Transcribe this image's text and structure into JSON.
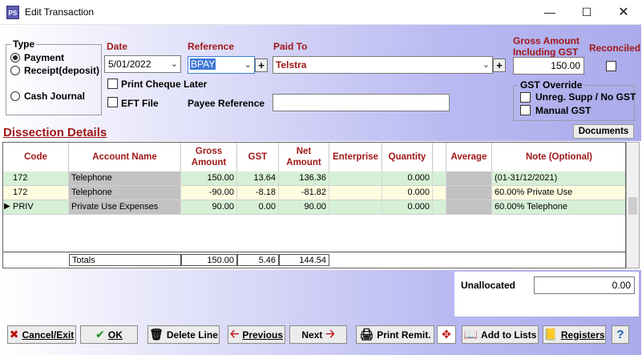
{
  "window": {
    "app_icon_text": "PS",
    "title": "Edit Transaction"
  },
  "type_group": {
    "legend": "Type",
    "options": [
      "Payment",
      "Receipt(deposit)",
      "Cash Journal"
    ],
    "selected": "Payment"
  },
  "fields": {
    "date_label": "Date",
    "date_value": "5/01/2022",
    "reference_label": "Reference",
    "reference_value": "BPAY",
    "paid_to_label": "Paid To",
    "paid_to_value": "Telstra",
    "gross_label": "Gross Amount Including GST",
    "gross_value": "150.00",
    "reconciled_label": "Reconciled",
    "print_cheque_label": "Print Cheque Later",
    "eft_label": "EFT File",
    "payee_ref_label": "Payee Reference",
    "payee_ref_value": ""
  },
  "gst_override": {
    "legend": "GST Override",
    "unreg_label": "Unreg. Supp / No GST",
    "manual_label": "Manual GST"
  },
  "dissection": {
    "title": "Dissection Details",
    "documents_label": "Documents",
    "columns": [
      "Code",
      "Account Name",
      "Gross Amount",
      "GST",
      "Net Amount",
      "Enterprise",
      "Quantity",
      "",
      "Average",
      "Note (Optional)"
    ],
    "rows": [
      {
        "code": "172",
        "account": "Telephone",
        "gross": "150.00",
        "gst": "13.64",
        "net": "136.36",
        "enterprise": "",
        "quantity": "0.000",
        "average": "",
        "note": "(01-31/12/2021)",
        "color": "#d6f0d6"
      },
      {
        "code": "172",
        "account": "Telephone",
        "gross": "-90.00",
        "gst": "-8.18",
        "net": "-81.82",
        "enterprise": "",
        "quantity": "0.000",
        "average": "",
        "note": "60.00% Private Use",
        "color": "#fffde0"
      },
      {
        "code": "PRIV",
        "account": "Private Use Expenses",
        "gross": "90.00",
        "gst": "0.00",
        "net": "90.00",
        "enterprise": "",
        "quantity": "0.000",
        "average": "",
        "note": "60.00% Telephone",
        "color": "#d6f0d6"
      }
    ],
    "row_pointer": "▶",
    "totals": {
      "label": "Totals",
      "gross": "150.00",
      "gst": "5.46",
      "net": "144.54"
    }
  },
  "unallocated": {
    "label": "Unallocated",
    "value": "0.00"
  },
  "buttons": {
    "cancel": "Cancel/Exit",
    "ok": "OK",
    "delete": "Delete Line",
    "previous": "Previous",
    "next": "Next",
    "print": "Print Remit.",
    "add_lists": "Add to Lists",
    "registers": "Registers",
    "help": "?"
  }
}
